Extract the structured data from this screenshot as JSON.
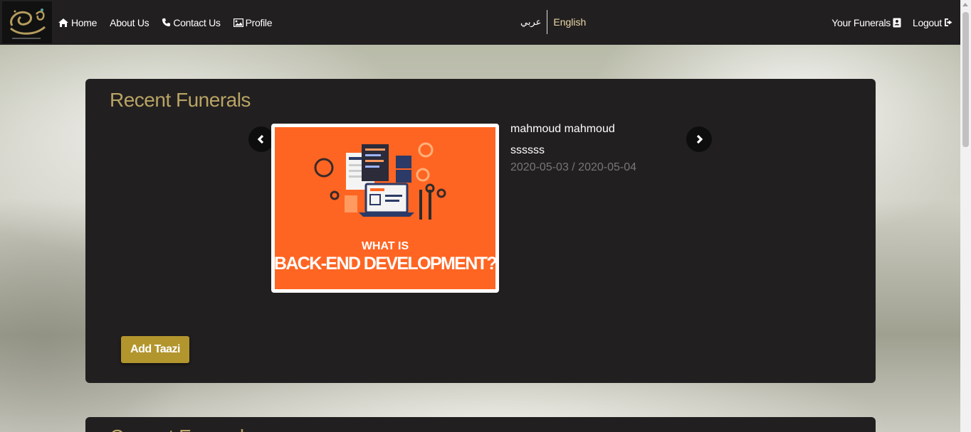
{
  "nav": {
    "logo_icon": "calligraphy-logo",
    "links": [
      {
        "label": "Home",
        "icon": "home-icon"
      },
      {
        "label": "About Us",
        "icon": ""
      },
      {
        "label": "Contact Us",
        "icon": "phone-icon"
      },
      {
        "label": "Profile",
        "icon": "image-icon"
      }
    ],
    "lang_ar": "عربي",
    "lang_en": "English",
    "right": [
      {
        "label": "Your Funerals",
        "icon": "address-book-icon"
      },
      {
        "label": "Logout",
        "icon": "sign-out-icon"
      }
    ]
  },
  "recent": {
    "title": "Recent Funerals",
    "item": {
      "image_caption_line1": "WHAT IS",
      "image_caption_line2": "BACK-END DEVELOPMENT?",
      "name": "mahmoud mahmoud",
      "text": "ssssss",
      "dates": "2020-05-03 / 2020-05-04"
    },
    "add_button": "Add Taazi"
  },
  "second": {
    "title": "Current Funerals"
  },
  "colors": {
    "navbar": "#221f20",
    "accent_gold": "#b8a464",
    "button_gold": "#b2952d",
    "image_orange": "#ff6522"
  }
}
